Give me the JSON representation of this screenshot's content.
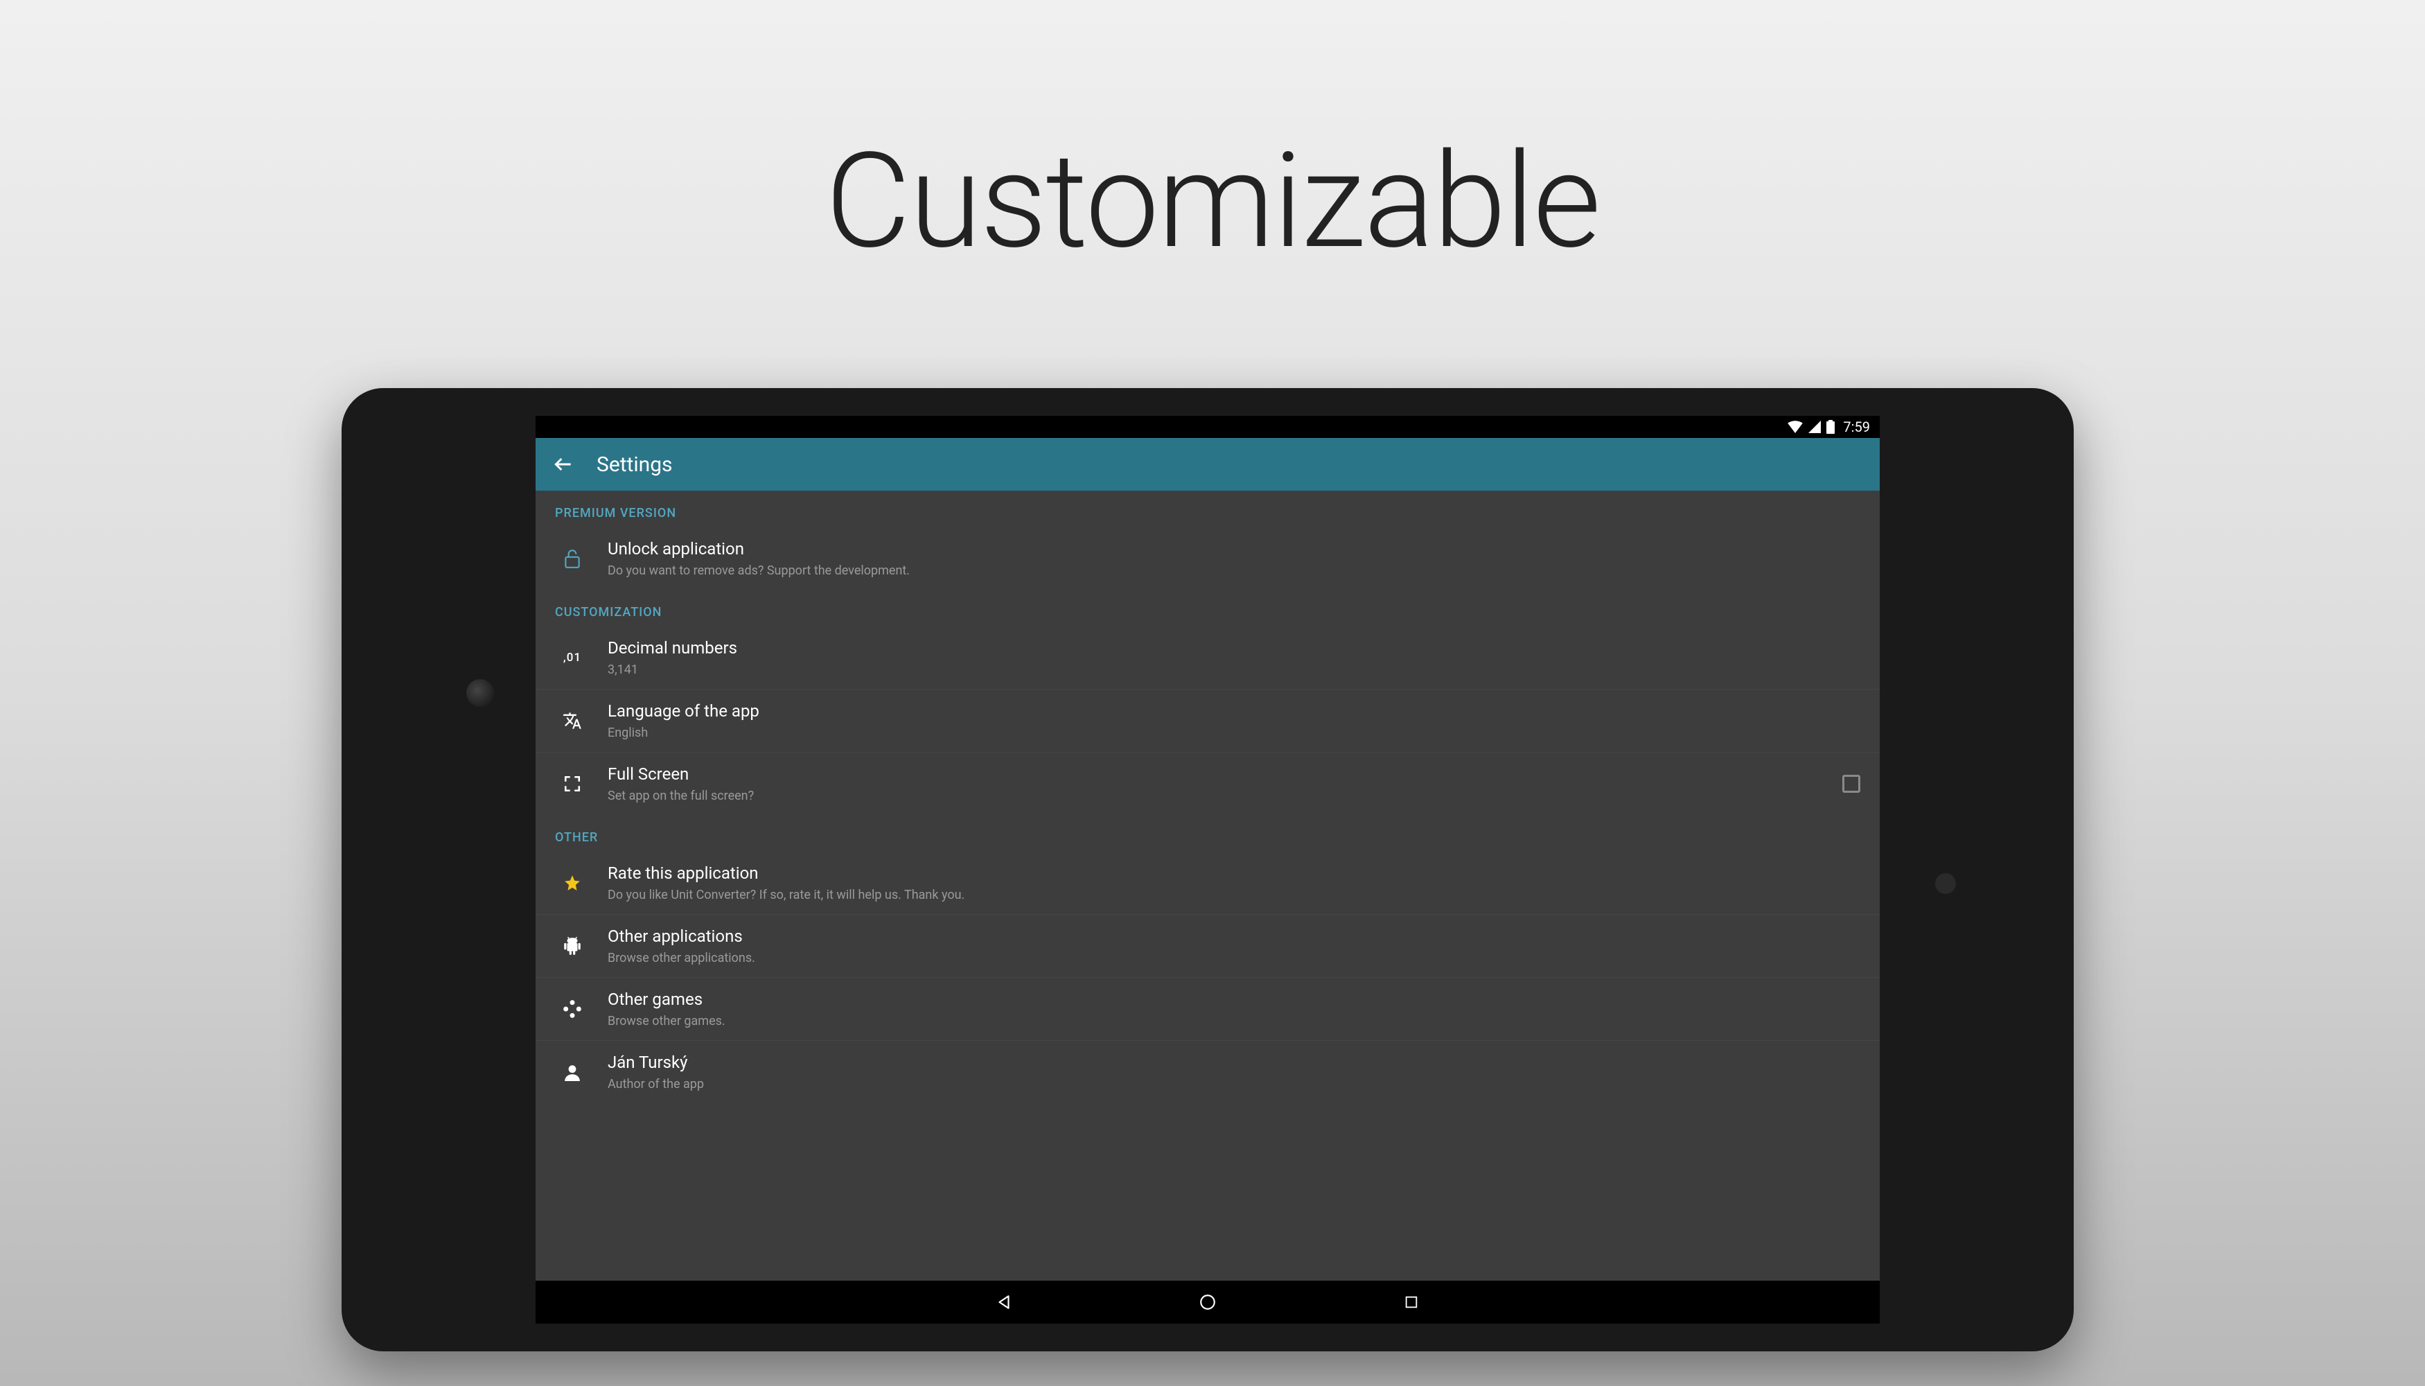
{
  "hero": {
    "title": "Customizable"
  },
  "status": {
    "time": "7:59"
  },
  "appbar": {
    "title": "Settings"
  },
  "sections": {
    "premium": {
      "header": "PREMIUM VERSION",
      "unlock": {
        "title": "Unlock application",
        "sub": "Do you want to remove ads? Support the development."
      }
    },
    "customization": {
      "header": "CUSTOMIZATION",
      "decimal": {
        "title": "Decimal numbers",
        "sub": "3,141",
        "icon_text": ",01"
      },
      "language": {
        "title": "Language of the app",
        "sub": "English"
      },
      "fullscreen": {
        "title": "Full Screen",
        "sub": "Set app on the full screen?"
      }
    },
    "other": {
      "header": "OTHER",
      "rate": {
        "title": "Rate this application",
        "sub": "Do you like Unit Converter? If so, rate it, it will help us. Thank you."
      },
      "apps": {
        "title": "Other applications",
        "sub": "Browse other applications."
      },
      "games": {
        "title": "Other games",
        "sub": "Browse other games."
      },
      "author": {
        "title": "Ján Turský",
        "sub": "Author of the app"
      }
    }
  }
}
